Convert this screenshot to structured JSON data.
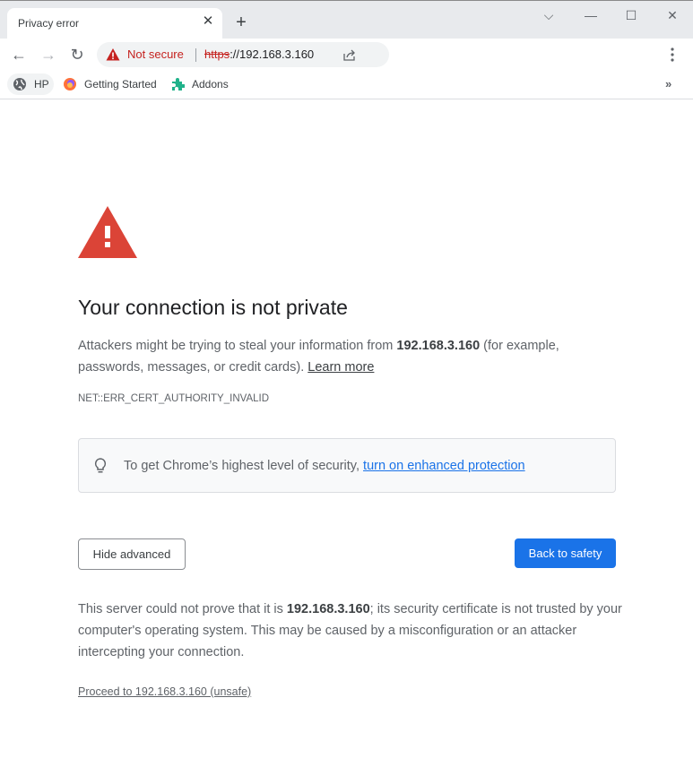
{
  "browser": {
    "tab": {
      "title": "Privacy error"
    },
    "address_bar": {
      "security_label": "Not secure",
      "url_scheme": "https",
      "url_rest": "://192.168.3.160"
    },
    "bookmarks": [
      {
        "label": "HP",
        "icon": "globe-icon"
      },
      {
        "label": "Getting Started",
        "icon": "firefox-icon"
      },
      {
        "label": "Addons",
        "icon": "puzzle-icon"
      }
    ],
    "window_controls": {
      "tab_search": "⌵",
      "minimize": "—",
      "maximize": "☐",
      "close": "✕"
    },
    "more_bookmarks": "»"
  },
  "page": {
    "heading": "Your connection is not private",
    "intro_before": "Attackers might be trying to steal your information from ",
    "host": "192.168.3.160",
    "intro_after": " (for example, passwords, messages, or credit cards). ",
    "learn_more": "Learn more",
    "error_code": "NET::ERR_CERT_AUTHORITY_INVALID",
    "enhanced_text": "To get Chrome’s highest level of security, ",
    "enhanced_link": "turn on enhanced protection",
    "hide_advanced": "Hide advanced",
    "back_to_safety": "Back to safety",
    "detail_before": "This server could not prove that it is ",
    "detail_after": "; its security certificate is not trusted by your computer's operating system. This may be caused by a misconfiguration or an attacker intercepting your connection.",
    "proceed_link": "Proceed to 192.168.3.160 (unsafe)"
  },
  "colors": {
    "danger": "#d93025",
    "primary": "#1a73e8",
    "link": "#1a73e8"
  }
}
